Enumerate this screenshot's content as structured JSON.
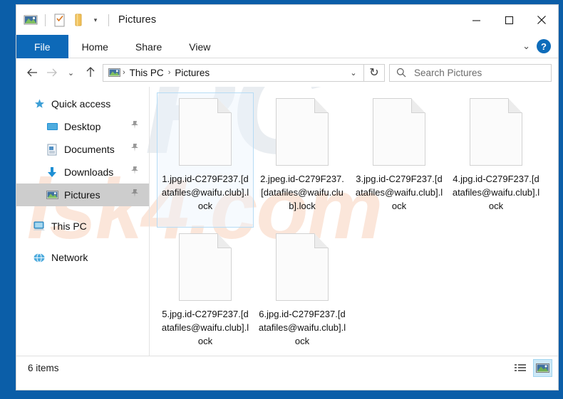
{
  "window": {
    "title": "Pictures",
    "quick_access_toolbar": [
      {
        "name": "pictures-folder-icon",
        "label": "Pictures"
      },
      {
        "name": "properties-icon",
        "label": "Properties"
      },
      {
        "name": "new-folder-icon",
        "label": "New folder"
      }
    ],
    "customize_dropdown": "▾",
    "controls": {
      "minimize": "—",
      "maximize": "□",
      "close": "✕"
    }
  },
  "ribbon": {
    "tabs": [
      {
        "label": "File",
        "active": true
      },
      {
        "label": "Home",
        "active": false
      },
      {
        "label": "Share",
        "active": false
      },
      {
        "label": "View",
        "active": false
      }
    ],
    "collapse_chevron": "⌄",
    "help_label": "?"
  },
  "address_bar": {
    "back": "←",
    "forward": "→",
    "recent_chevron": "⌄",
    "up": "↑",
    "breadcrumb_icon": "pictures-icon",
    "crumbs": [
      "This PC",
      "Pictures"
    ],
    "crumb_separator": "›",
    "path_dropdown": "⌄",
    "refresh": "↻"
  },
  "search": {
    "placeholder": "Search Pictures",
    "icon": "search-icon"
  },
  "sidebar": {
    "items": [
      {
        "label": "Quick access",
        "icon": "star-pin-icon",
        "child": false,
        "pinned": false,
        "selected": false
      },
      {
        "label": "Desktop",
        "icon": "desktop-icon",
        "child": true,
        "pinned": true,
        "selected": false
      },
      {
        "label": "Documents",
        "icon": "documents-icon",
        "child": true,
        "pinned": true,
        "selected": false
      },
      {
        "label": "Downloads",
        "icon": "downloads-icon",
        "child": true,
        "pinned": true,
        "selected": false
      },
      {
        "label": "Pictures",
        "icon": "pictures-icon",
        "child": true,
        "pinned": true,
        "selected": true
      },
      {
        "label": "This PC",
        "icon": "this-pc-icon",
        "child": false,
        "pinned": false,
        "selected": false
      },
      {
        "label": "Network",
        "icon": "network-icon",
        "child": false,
        "pinned": false,
        "selected": false
      }
    ]
  },
  "files": [
    {
      "name": "1.jpg.id-C279F237.[datafiles@waifu.club].lock",
      "icon": "blank-file-icon",
      "selected": true
    },
    {
      "name": "2.jpeg.id-C279F237.[datafiles@waifu.club].lock",
      "icon": "blank-file-icon",
      "selected": false
    },
    {
      "name": "3.jpg.id-C279F237.[datafiles@waifu.club].lock",
      "icon": "blank-file-icon",
      "selected": false
    },
    {
      "name": "4.jpg.id-C279F237.[datafiles@waifu.club].lock",
      "icon": "blank-file-icon",
      "selected": false
    },
    {
      "name": "5.jpg.id-C279F237.[datafiles@waifu.club].lock",
      "icon": "blank-file-icon",
      "selected": false
    },
    {
      "name": "6.jpg.id-C279F237.[datafiles@waifu.club].lock",
      "icon": "blank-file-icon",
      "selected": false
    }
  ],
  "status_bar": {
    "item_count": "6 items",
    "views": [
      {
        "name": "details-view-button",
        "active": false
      },
      {
        "name": "large-icons-view-button",
        "active": true
      }
    ]
  },
  "watermark": {
    "top": "PC",
    "bottom": "risk4.com"
  },
  "colors": {
    "desktop_blue": "#0b5ea8",
    "accent_blue": "#0d69b8",
    "selection_blue": "#b6dcf5",
    "sidebar_selected": "#cdcdcd"
  }
}
